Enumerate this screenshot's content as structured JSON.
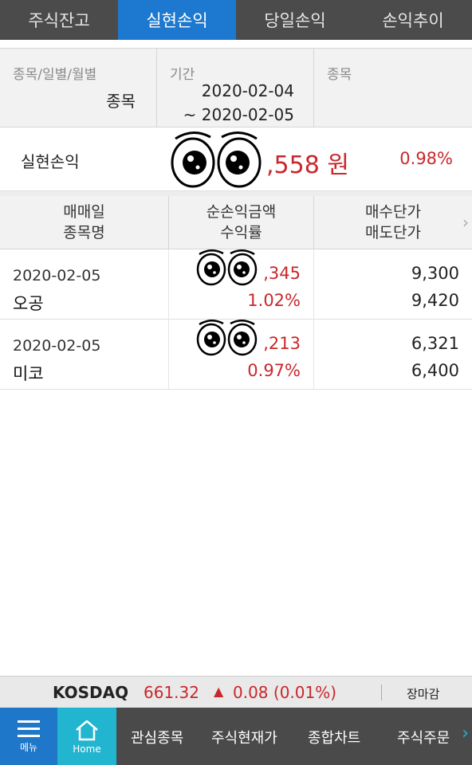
{
  "tabs": [
    "주식잔고",
    "실현손익",
    "당일손익",
    "손익추이"
  ],
  "filter": {
    "type_label": "종목/일별/월별",
    "type_value": "종목",
    "period_label": "기간",
    "period_from": "2020-02-04",
    "period_to": "~ 2020-02-05",
    "stock_label": "종목"
  },
  "summary": {
    "label": "실현손익",
    "amount": ",558 원",
    "rate": "0.98%"
  },
  "table": {
    "headers": [
      {
        "line1": "매매일",
        "line2": "종목명"
      },
      {
        "line1": "순손익금액",
        "line2": "수익률"
      },
      {
        "line1": "매수단가",
        "line2": "매도단가"
      }
    ],
    "rows": [
      {
        "date": "2020-02-05",
        "name": "오공",
        "amount": ",345",
        "rate": "1.02%",
        "buy": "9,300",
        "sell": "9,420"
      },
      {
        "date": "2020-02-05",
        "name": "미코",
        "amount": ",213",
        "rate": "0.97%",
        "buy": "6,321",
        "sell": "6,400"
      }
    ]
  },
  "ticker": {
    "name": "KOSDAQ",
    "value": "661.32",
    "arrow": "▲",
    "change": "0.08 (0.01%)",
    "status": "장마감"
  },
  "bottom_nav": {
    "menu": "메뉴",
    "home": "Home",
    "items": [
      "관심종목",
      "주식현재가",
      "종합차트",
      "주식주문"
    ]
  },
  "colors": {
    "accent": "#1d79cf",
    "home": "#22b5cf",
    "up": "#c9272b"
  }
}
